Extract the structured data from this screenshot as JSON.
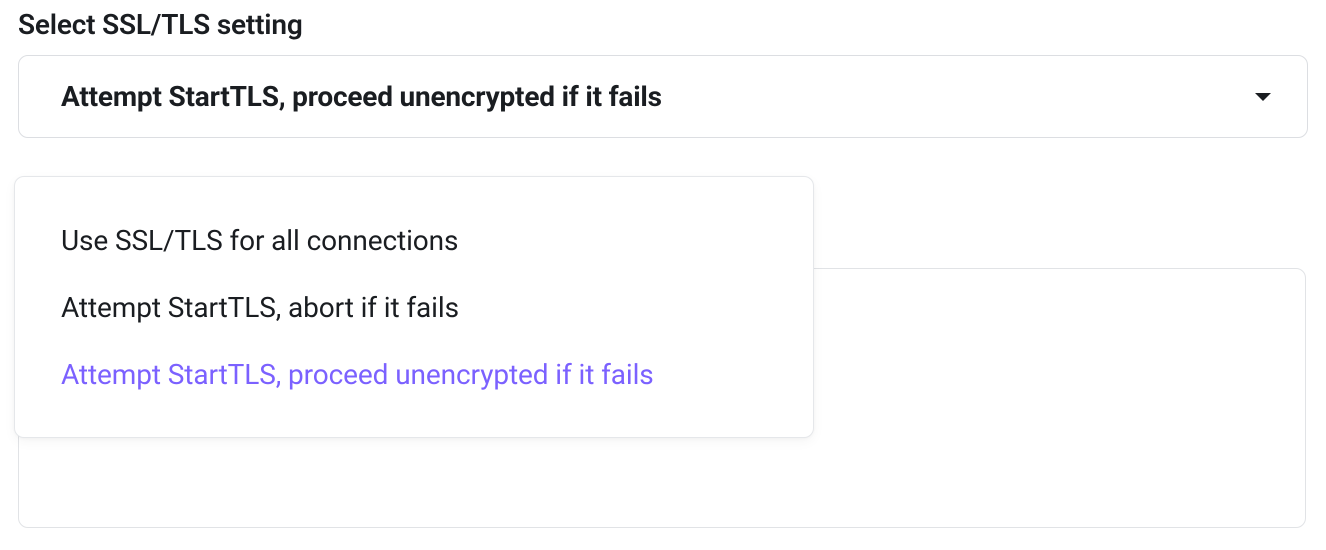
{
  "field": {
    "label": "Select SSL/TLS setting",
    "selected_value": "Attempt StartTLS, proceed unencrypted if it fails"
  },
  "options": [
    {
      "label": "Use SSL/TLS for all connections",
      "selected": false
    },
    {
      "label": "Attempt StartTLS, abort if it fails",
      "selected": false
    },
    {
      "label": "Attempt StartTLS, proceed unencrypted if it fails",
      "selected": true
    }
  ],
  "colors": {
    "text": "#1a1d21",
    "border": "#dcdee2",
    "selected": "#7b61ff"
  }
}
